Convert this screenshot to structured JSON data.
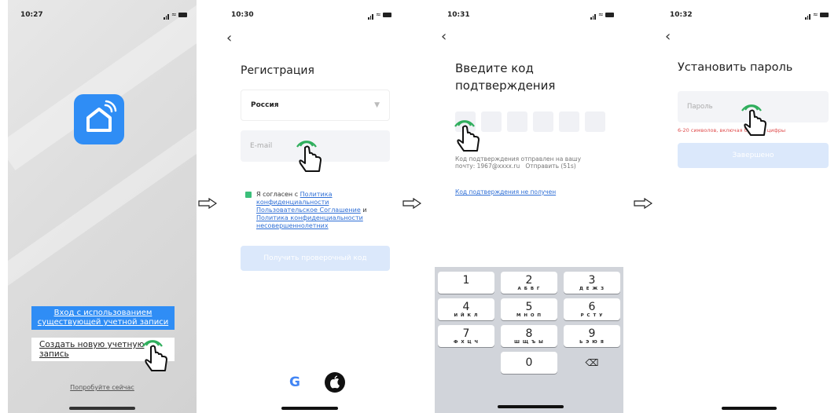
{
  "screen1": {
    "time": "10:27",
    "login_existing": "Вход с использованием существующей учетной записи",
    "create_account": "Создать новую учетную запись",
    "try_now": "Попробуйте сейчас"
  },
  "screen2": {
    "time": "10:30",
    "back": "‹",
    "title": "Регистрация",
    "country": "Россия",
    "email_placeholder": "E-mail",
    "agree_prefix": "Я согласен с ",
    "link_privacy": "Политика конфиденциальности",
    "link_terms": "Пользовательское Соглашение",
    "agree_and": " и ",
    "link_minors": "Политика конфиденциальности несовершеннолетних",
    "get_code": "Получить проверочный код",
    "google_letter": "G"
  },
  "screen3": {
    "time": "10:31",
    "back": "‹",
    "title": "Введите код подтверждения",
    "sent_line1": "Код подтверждения отправлен на вашу",
    "sent_line2": "почту: 1967@xxxx.ru",
    "resend": "Отправить (51s)",
    "not_received": "Код подтверждения не получен",
    "keys": [
      {
        "n": "1",
        "l": ""
      },
      {
        "n": "2",
        "l": "А Б В Г"
      },
      {
        "n": "3",
        "l": "Д Е Ж З"
      },
      {
        "n": "4",
        "l": "И Й К Л"
      },
      {
        "n": "5",
        "l": "М Н О П"
      },
      {
        "n": "6",
        "l": "Р С Т У"
      },
      {
        "n": "7",
        "l": "Ф Х Ц Ч"
      },
      {
        "n": "8",
        "l": "Ш Щ Ъ Ы"
      },
      {
        "n": "9",
        "l": "Ь Э Ю Я"
      },
      {
        "n": "0",
        "l": ""
      }
    ],
    "delete_key": "⌫"
  },
  "screen4": {
    "time": "10:32",
    "back": "‹",
    "title": "Установить пароль",
    "password_placeholder": "Пароль",
    "password_hint": "6-20 символов, включая буквы и цифры",
    "finish": "Завершено"
  },
  "colors": {
    "primary": "#2f8df5",
    "disabled_button": "#dbe8fb",
    "link": "#2f6fd6",
    "checkbox": "#3bbf7a",
    "hint_red": "#e05050",
    "touch_green": "#2fae5c"
  },
  "icons": [
    "smart-home-app-icon",
    "tap-hand-icon",
    "arrow-right-icon",
    "google-icon",
    "apple-icon"
  ]
}
